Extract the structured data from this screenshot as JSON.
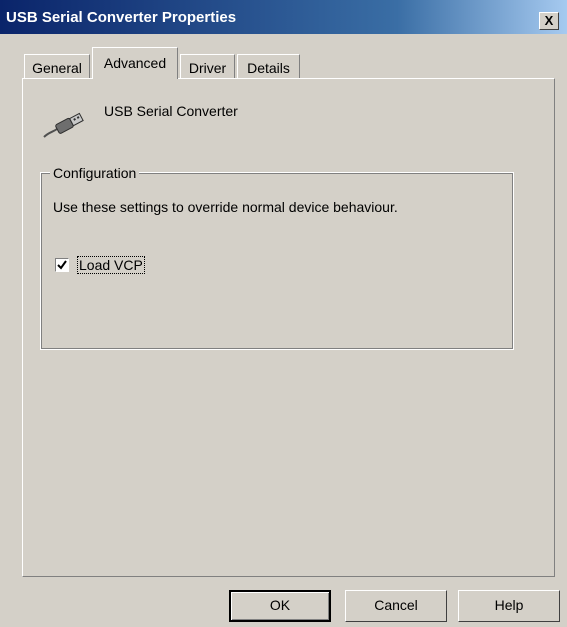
{
  "window": {
    "title": "USB Serial Converter Properties",
    "close_label": "X"
  },
  "tabs": [
    {
      "label": "General",
      "selected": false
    },
    {
      "label": "Advanced",
      "selected": true
    },
    {
      "label": "Driver",
      "selected": false
    },
    {
      "label": "Details",
      "selected": false
    }
  ],
  "device": {
    "icon": "usb-plug-icon",
    "name": "USB Serial Converter"
  },
  "configuration": {
    "title": "Configuration",
    "description": "Use these settings to override normal device behaviour.",
    "load_vcp": {
      "label": "Load VCP",
      "checked": true
    }
  },
  "buttons": {
    "ok": "OK",
    "cancel": "Cancel",
    "help": "Help"
  },
  "colors": {
    "dialog_face": "#d4d0c8",
    "title_bar_start": "#0a246a",
    "title_bar_end": "#a6caf0"
  }
}
